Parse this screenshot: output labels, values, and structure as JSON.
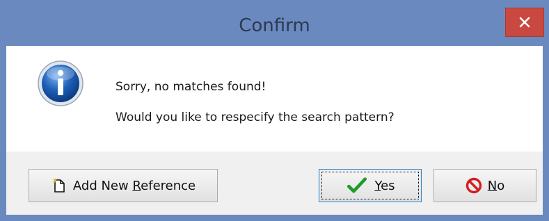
{
  "window": {
    "title": "Confirm"
  },
  "message": {
    "line1": "Sorry, no matches found!",
    "line2": "Would you like to respecify the search pattern?"
  },
  "buttons": {
    "add_reference": {
      "pre": "Add New ",
      "accel": "R",
      "post": "eference",
      "icon": "new-document-icon"
    },
    "yes": {
      "accel": "Y",
      "post": "es",
      "icon": "checkmark-icon"
    },
    "no": {
      "accel": "N",
      "post": "o",
      "icon": "no-entry-icon"
    }
  },
  "colors": {
    "titlebar": "#6a89be",
    "close": "#c9483f",
    "check": "#1e9a2a",
    "no": "#d11f1f",
    "info": "#1d5fb8"
  }
}
